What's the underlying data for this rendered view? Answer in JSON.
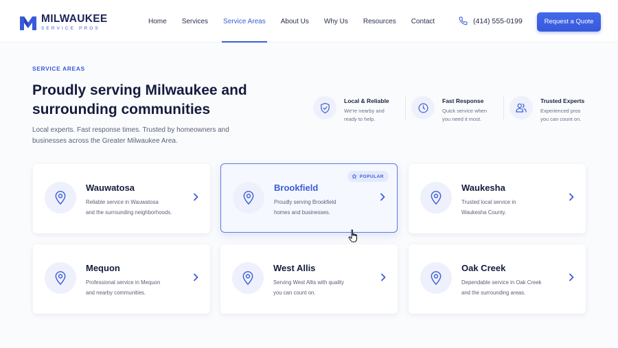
{
  "header": {
    "logo_title": "MILWAUKEE",
    "logo_subtitle": "SERVICE PROS",
    "nav": [
      {
        "label": "Home"
      },
      {
        "label": "Services"
      },
      {
        "label": "Service Areas"
      },
      {
        "label": "About Us"
      },
      {
        "label": "Why Us"
      },
      {
        "label": "Resources"
      },
      {
        "label": "Contact"
      }
    ],
    "active_nav": "Service Areas",
    "phone": "(414) 555-0199",
    "cta_label": "Request a Quote"
  },
  "hero": {
    "eyebrow": "SERVICE AREAS",
    "headline": "Proudly serving Milwaukee and surrounding communities",
    "intro": "Local experts. Fast response times. Trusted by homeowners and businesses across the Greater Milwaukee Area."
  },
  "features": [
    {
      "icon": "shield-check-icon",
      "title": "Local & Reliable",
      "desc_line1": "We're nearby and",
      "desc_line2": "ready to help."
    },
    {
      "icon": "clock-icon",
      "title": "Fast Response",
      "desc_line1": "Quick service when",
      "desc_line2": "you need it most."
    },
    {
      "icon": "users-icon",
      "title": "Trusted Experts",
      "desc_line1": "Experienced pros",
      "desc_line2": "you can count on."
    }
  ],
  "areas": [
    {
      "name": "Wauwatosa",
      "desc_line1": "Reliable service in Wauwatosa",
      "desc_line2": "and the surrounding neighborhoods."
    },
    {
      "name": "Brookfield",
      "desc_line1": "Proudly serving Brookfield",
      "desc_line2": "homes and businesses.",
      "badge": "POPULAR"
    },
    {
      "name": "Waukesha",
      "desc_line1": "Trusted local service in",
      "desc_line2": "Waukesha County."
    },
    {
      "name": "Mequon",
      "desc_line1": "Professional service in Mequon",
      "desc_line2": "and nearby communities."
    },
    {
      "name": "West Allis",
      "desc_line1": "Serving West Allis with quality",
      "desc_line2": "you can count on."
    },
    {
      "name": "Oak Creek",
      "desc_line1": "Dependable service in Oak Creek",
      "desc_line2": "and the surrounding areas."
    }
  ],
  "colors": {
    "accent": "#3a5bd8",
    "navy": "#141b3d",
    "icon_bg": "#eef1fb"
  }
}
